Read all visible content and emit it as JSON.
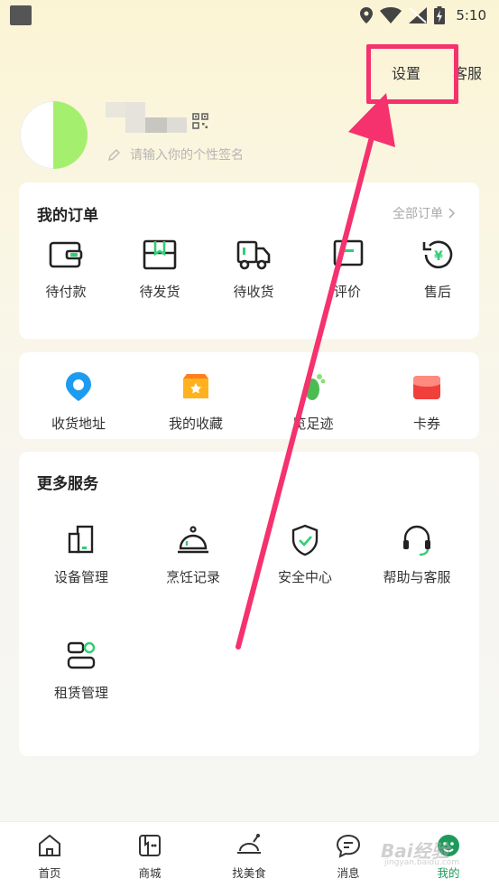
{
  "status_bar": {
    "time": "5:10"
  },
  "header": {
    "settings_label": "设置",
    "service_label": "客服"
  },
  "profile": {
    "signature_placeholder": "请输入你的个性签名"
  },
  "orders": {
    "title": "我的订单",
    "all_orders_label": "全部订单",
    "items": [
      {
        "label": "待付款",
        "icon": "wallet-icon"
      },
      {
        "label": "待发货",
        "icon": "box-icon"
      },
      {
        "label": "待收货",
        "icon": "truck-icon"
      },
      {
        "label": "评价",
        "icon": "review-icon"
      },
      {
        "label": "售后",
        "icon": "refund-icon"
      }
    ]
  },
  "quick": {
    "items": [
      {
        "label": "收货地址",
        "icon": "location-pin-icon",
        "color": "#1e9bf0"
      },
      {
        "label": "我的收藏",
        "icon": "star-box-icon",
        "color": "#ffb21e"
      },
      {
        "label": "览足迹",
        "icon": "footprint-icon",
        "color": "#4cbc52"
      },
      {
        "label": "卡券",
        "icon": "coupon-icon",
        "color": "#f0403c"
      }
    ]
  },
  "services": {
    "title": "更多服务",
    "items": [
      {
        "label": "设备管理",
        "icon": "device-icon"
      },
      {
        "label": "烹饪记录",
        "icon": "cloche-icon"
      },
      {
        "label": "安全中心",
        "icon": "shield-check-icon"
      },
      {
        "label": "帮助与客服",
        "icon": "headset-icon"
      },
      {
        "label": "租赁管理",
        "icon": "lease-icon"
      }
    ]
  },
  "bottom_nav": {
    "items": [
      {
        "label": "首页",
        "icon": "home-icon"
      },
      {
        "label": "商城",
        "icon": "mall-icon"
      },
      {
        "label": "找美食",
        "icon": "food-icon"
      },
      {
        "label": "消息",
        "icon": "message-icon"
      },
      {
        "label": "我的",
        "icon": "profile-icon",
        "active": true
      }
    ]
  },
  "colors": {
    "accent": "#1d9a5b",
    "highlight": "#f5316e",
    "avatar_green": "#a5ef6e"
  }
}
